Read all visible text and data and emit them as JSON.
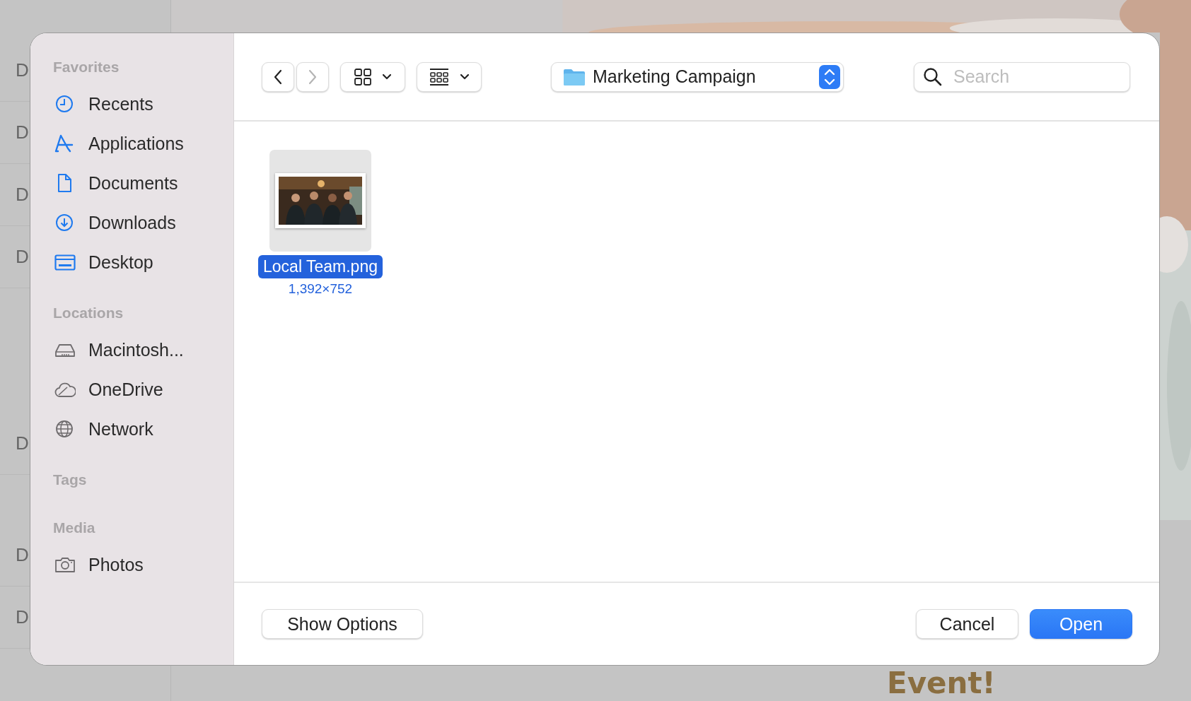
{
  "background": {
    "list_labels": [
      "D",
      "D",
      "D",
      "D",
      "D",
      "D",
      "D"
    ],
    "headline_fragments": [
      "Event!"
    ]
  },
  "dialog": {
    "sidebar": {
      "sections": [
        {
          "title": "Favorites",
          "items": [
            {
              "label": "Recents",
              "kind": "clock"
            },
            {
              "label": "Applications",
              "kind": "apps"
            },
            {
              "label": "Documents",
              "kind": "document"
            },
            {
              "label": "Downloads",
              "kind": "download"
            },
            {
              "label": "Desktop",
              "kind": "desktop"
            }
          ]
        },
        {
          "title": "Locations",
          "items": [
            {
              "label": "Macintosh...",
              "kind": "disk"
            },
            {
              "label": "OneDrive",
              "kind": "cloud"
            },
            {
              "label": "Network",
              "kind": "globe"
            }
          ]
        },
        {
          "title": "Tags"
        },
        {
          "title": "Media",
          "items": [
            {
              "label": "Photos",
              "kind": "camera"
            }
          ]
        }
      ]
    },
    "toolbar": {
      "back": {
        "disabled": false
      },
      "forward": {
        "disabled": true
      },
      "location": "Marketing Campaign",
      "search": {
        "placeholder": "Search"
      }
    },
    "files": [
      {
        "name": "Local Team.png",
        "dimensions": "1,392×752",
        "selected": true
      }
    ],
    "buttons": [
      {
        "label": "Show Options",
        "kind": "secondary"
      },
      {
        "label": "Cancel",
        "kind": "secondary"
      },
      {
        "label": "Open",
        "kind": "default"
      }
    ]
  }
}
